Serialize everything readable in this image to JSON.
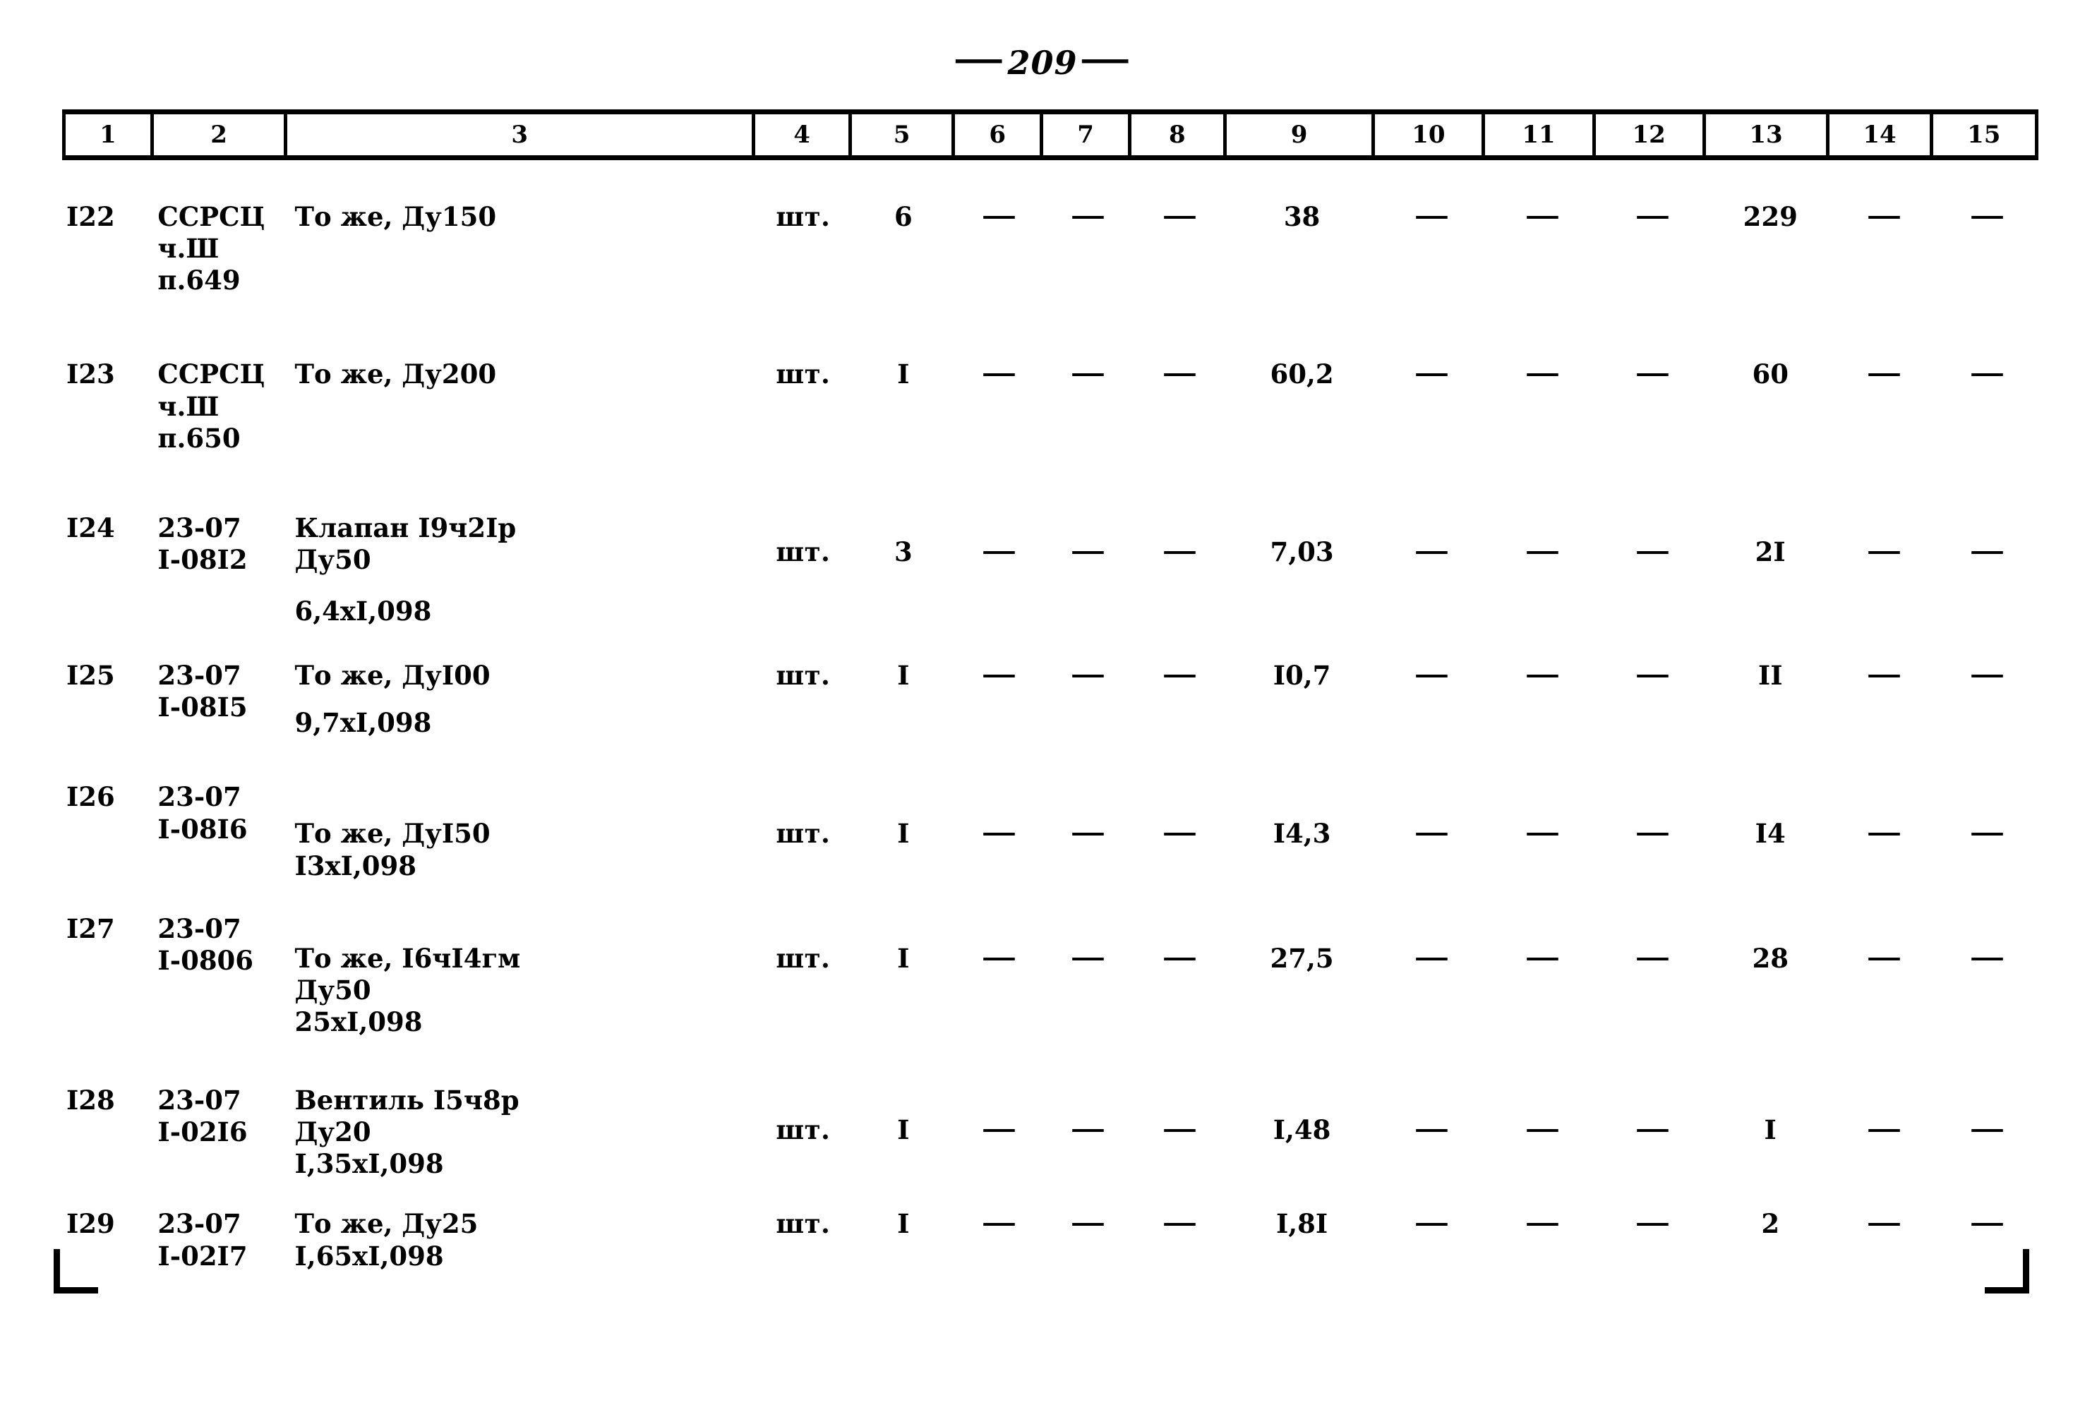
{
  "document": {
    "page_number": "209",
    "folio_left_dash": "—",
    "folio_right_dash": "—"
  },
  "table": {
    "column_headers": [
      "1",
      "2",
      "3",
      "4",
      "5",
      "6",
      "7",
      "8",
      "9",
      "10",
      "11",
      "12",
      "13",
      "14",
      "15"
    ],
    "dash": "—",
    "rows": [
      {
        "pos": "I22",
        "code": "ССРСЦ\nч.Ш\nп.649",
        "name": "То же, Ду150",
        "unit": "шт.",
        "c5": "6",
        "c6": "—",
        "c7": "—",
        "c8": "—",
        "c9": "38",
        "c10": "—",
        "c11": "—",
        "c12": "—",
        "c13": "229",
        "c14": "—",
        "c15": "—"
      },
      {
        "pos": "I23",
        "code": "ССРСЦ\nч.Ш\nп.650",
        "name": "То же, Ду200",
        "unit": "шт.",
        "c5": "I",
        "c6": "—",
        "c7": "—",
        "c8": "—",
        "c9": "60,2",
        "c10": "—",
        "c11": "—",
        "c12": "—",
        "c13": "60",
        "c14": "—",
        "c15": "—"
      },
      {
        "pos": "I24",
        "code": "23-07\nI-08I2",
        "name": "Клапан I9ч2Iр\nДу50",
        "name_extra": "6,4хI,098",
        "unit": "шт.",
        "c5": "3",
        "c6": "—",
        "c7": "—",
        "c8": "—",
        "c9": "7,03",
        "c10": "—",
        "c11": "—",
        "c12": "—",
        "c13": "2I",
        "c14": "—",
        "c15": "—"
      },
      {
        "pos": "I25",
        "code": "23-07\nI-08I5",
        "name": "То же, ДуI00",
        "name_extra": "9,7хI,098",
        "unit": "шт.",
        "c5": "I",
        "c6": "—",
        "c7": "—",
        "c8": "—",
        "c9": "I0,7",
        "c10": "—",
        "c11": "—",
        "c12": "—",
        "c13": "II",
        "c14": "—",
        "c15": "—"
      },
      {
        "pos": "I26",
        "code": "23-07\nI-08I6",
        "name": "То же, ДуI50\nI3хI,098",
        "unit": "шт.",
        "c5": "I",
        "c6": "—",
        "c7": "—",
        "c8": "—",
        "c9": "I4,3",
        "c10": "—",
        "c11": "—",
        "c12": "—",
        "c13": "I4",
        "c14": "—",
        "c15": "—"
      },
      {
        "pos": "I27",
        "code": "23-07\nI-0806",
        "name": "То же, I6чI4гм\nДу50\n25хI,098",
        "unit": "шт.",
        "c5": "I",
        "c6": "—",
        "c7": "—",
        "c8": "—",
        "c9": "27,5",
        "c10": "—",
        "c11": "—",
        "c12": "—",
        "c13": "28",
        "c14": "—",
        "c15": "—"
      },
      {
        "pos": "I28",
        "code": "23-07\nI-02I6",
        "name": "Вентиль I5ч8р\nДу20\nI,35хI,098",
        "unit": "шт.",
        "c5": "I",
        "c6": "—",
        "c7": "—",
        "c8": "—",
        "c9": "I,48",
        "c10": "—",
        "c11": "—",
        "c12": "—",
        "c13": "I",
        "c14": "—",
        "c15": "—"
      },
      {
        "pos": "I29",
        "code": "23-07\nI-02I7",
        "name": "То же, Ду25\nI,65хI,098",
        "unit": "шт.",
        "c5": "I",
        "c6": "—",
        "c7": "—",
        "c8": "—",
        "c9": "I,8I",
        "c10": "—",
        "c11": "—",
        "c12": "—",
        "c13": "2",
        "c14": "—",
        "c15": "—"
      }
    ]
  }
}
